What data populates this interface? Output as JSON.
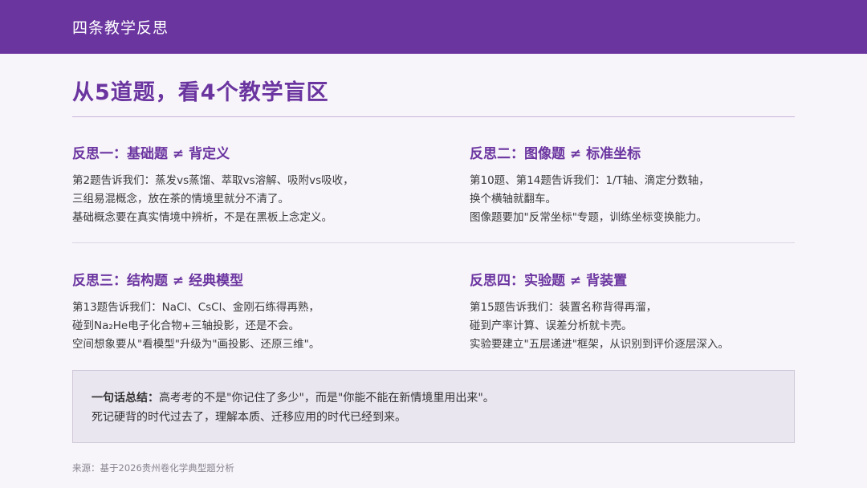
{
  "header": {
    "title": "四条教学反思"
  },
  "main": {
    "title": "从5道题，看4个教学盲区"
  },
  "reflections": [
    {
      "title": "反思一：基础题 ≠ 背定义",
      "lines": [
        "第2题告诉我们：蒸发vs蒸馏、萃取vs溶解、吸附vs吸收，",
        "三组易混概念，放在茶的情境里就分不清了。",
        "基础概念要在真实情境中辨析，不是在黑板上念定义。"
      ]
    },
    {
      "title": "反思二：图像题 ≠ 标准坐标",
      "lines": [
        "第10题、第14题告诉我们：1/T轴、滴定分数轴，",
        "换个横轴就翻车。",
        "图像题要加\"反常坐标\"专题，训练坐标变换能力。"
      ]
    },
    {
      "title": "反思三：结构题 ≠ 经典模型",
      "lines": [
        "第13题告诉我们：NaCl、CsCl、金刚石练得再熟，",
        "碰到Na₂He电子化合物+三轴投影，还是不会。",
        "空间想象要从\"看模型\"升级为\"画投影、还原三维\"。"
      ]
    },
    {
      "title": "反思四：实验题 ≠ 背装置",
      "lines": [
        "第15题告诉我们：装置名称背得再溜，",
        "碰到产率计算、误差分析就卡壳。",
        "实验要建立\"五层递进\"框架，从识别到评价逐层深入。"
      ]
    }
  ],
  "summary": {
    "label": "一句话总结：",
    "line1": "高考考的不是\"你记住了多少\"，而是\"你能不能在新情境里用出来\"。",
    "line2": "死记硬背的时代过去了，理解本质、迁移应用的时代已经到来。"
  },
  "footer": {
    "source": "来源：基于2026贵州卷化学典型题分析"
  },
  "colors": {
    "accent": "#6b35a0",
    "background": "#f7f4fa",
    "summary_bg": "#eae6f0"
  }
}
